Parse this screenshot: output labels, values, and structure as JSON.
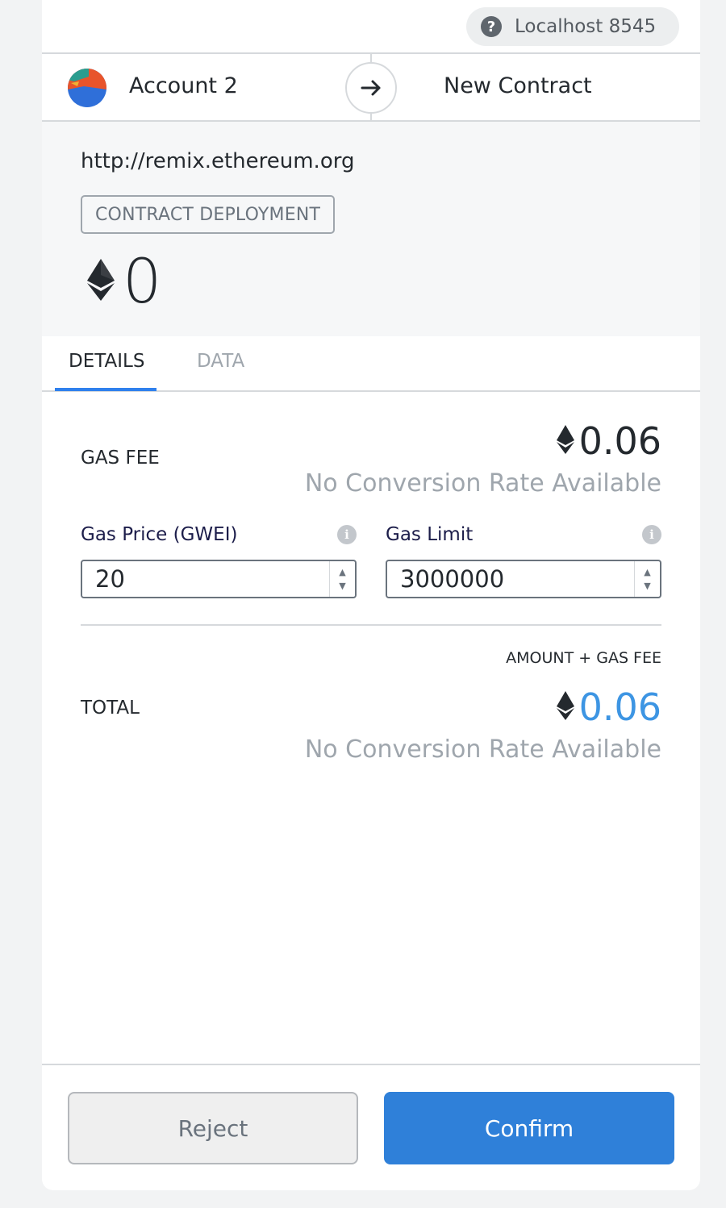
{
  "network": {
    "label": "Localhost 8545",
    "help_icon": "question-circle-icon"
  },
  "sender": {
    "name": "Account 2",
    "avatar_colors": [
      "#e8542b",
      "#2f6fd9",
      "#2a9d8f",
      "#f0b135"
    ]
  },
  "transfer_arrow_icon": "arrow-right-icon",
  "recipient": {
    "name": "New Contract"
  },
  "summary": {
    "origin": "http://remix.ethereum.org",
    "action": "CONTRACT DEPLOYMENT",
    "amount": "0",
    "currency_icon": "ethereum-icon"
  },
  "tabs": [
    {
      "label": "DETAILS",
      "active": true
    },
    {
      "label": "DATA",
      "active": false
    }
  ],
  "details": {
    "gas_fee_label": "GAS FEE",
    "gas_fee_value": "0.06",
    "gas_fee_conversion": "No Conversion Rate Available",
    "gas_price_label": "Gas Price (GWEI)",
    "gas_price_value": "20",
    "gas_limit_label": "Gas Limit",
    "gas_limit_value": "3000000",
    "info_icon": "info-circle-icon",
    "total_sublabel": "AMOUNT + GAS FEE",
    "total_label": "TOTAL",
    "total_value": "0.06",
    "total_conversion": "No Conversion Rate Available"
  },
  "footer": {
    "reject_label": "Reject",
    "confirm_label": "Confirm"
  },
  "colors": {
    "accent": "#2f80d9",
    "total_value": "#3d95e3",
    "muted": "#9fa6ad"
  }
}
